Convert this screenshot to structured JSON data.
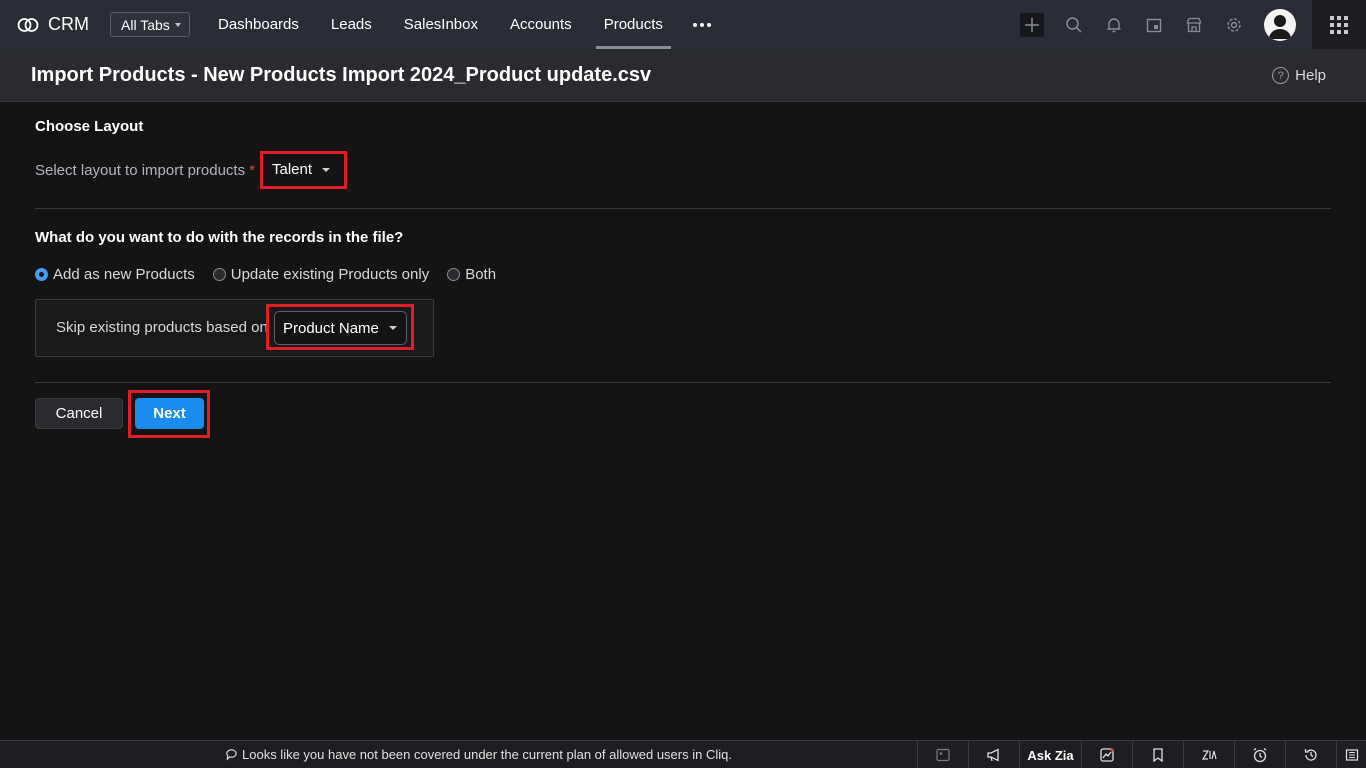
{
  "topbar": {
    "app_name": "CRM",
    "all_tabs_label": "All Tabs",
    "nav_items": [
      {
        "label": "Dashboards"
      },
      {
        "label": "Leads"
      },
      {
        "label": "SalesInbox"
      },
      {
        "label": "Accounts"
      },
      {
        "label": "Products",
        "active": true
      }
    ],
    "icons": [
      "plus-icon",
      "search-icon",
      "bell-icon",
      "calendar-icon",
      "store-icon",
      "gear-icon",
      "avatar",
      "apps-grid-icon"
    ]
  },
  "header": {
    "title": "Import Products - New Products Import 2024_Product update.csv",
    "help_label": "Help",
    "help_icon": "question-circle-icon"
  },
  "layout_section": {
    "title": "Choose Layout",
    "field_label": "Select layout to import products",
    "required_mark": "*",
    "selected_layout": "Talent"
  },
  "records_section": {
    "title": "What do you want to do with the records in the file?",
    "options": [
      {
        "label": "Add as new Products",
        "checked": true
      },
      {
        "label": "Update existing Products only",
        "checked": false
      },
      {
        "label": "Both",
        "checked": false
      }
    ],
    "skip_label": "Skip existing products based on",
    "skip_field_value": "Product Name"
  },
  "actions": {
    "cancel_label": "Cancel",
    "next_label": "Next"
  },
  "bottombar": {
    "notice_text": "Looks like you have not been covered under the current plan of allowed users in Cliq.",
    "ask_zia_label": "Ask Zia",
    "icons": [
      "chat-image-icon",
      "megaphone-icon",
      "ask-zia",
      "chart-icon",
      "bookmark-icon",
      "zia-icon",
      "alarm-icon",
      "history-icon",
      "sidebar-icon"
    ]
  },
  "colors": {
    "topbar_bg": "#2a2d35",
    "page_bg": "#141414",
    "accent_blue": "#1a8cf0",
    "highlight_red": "#e01e26"
  }
}
